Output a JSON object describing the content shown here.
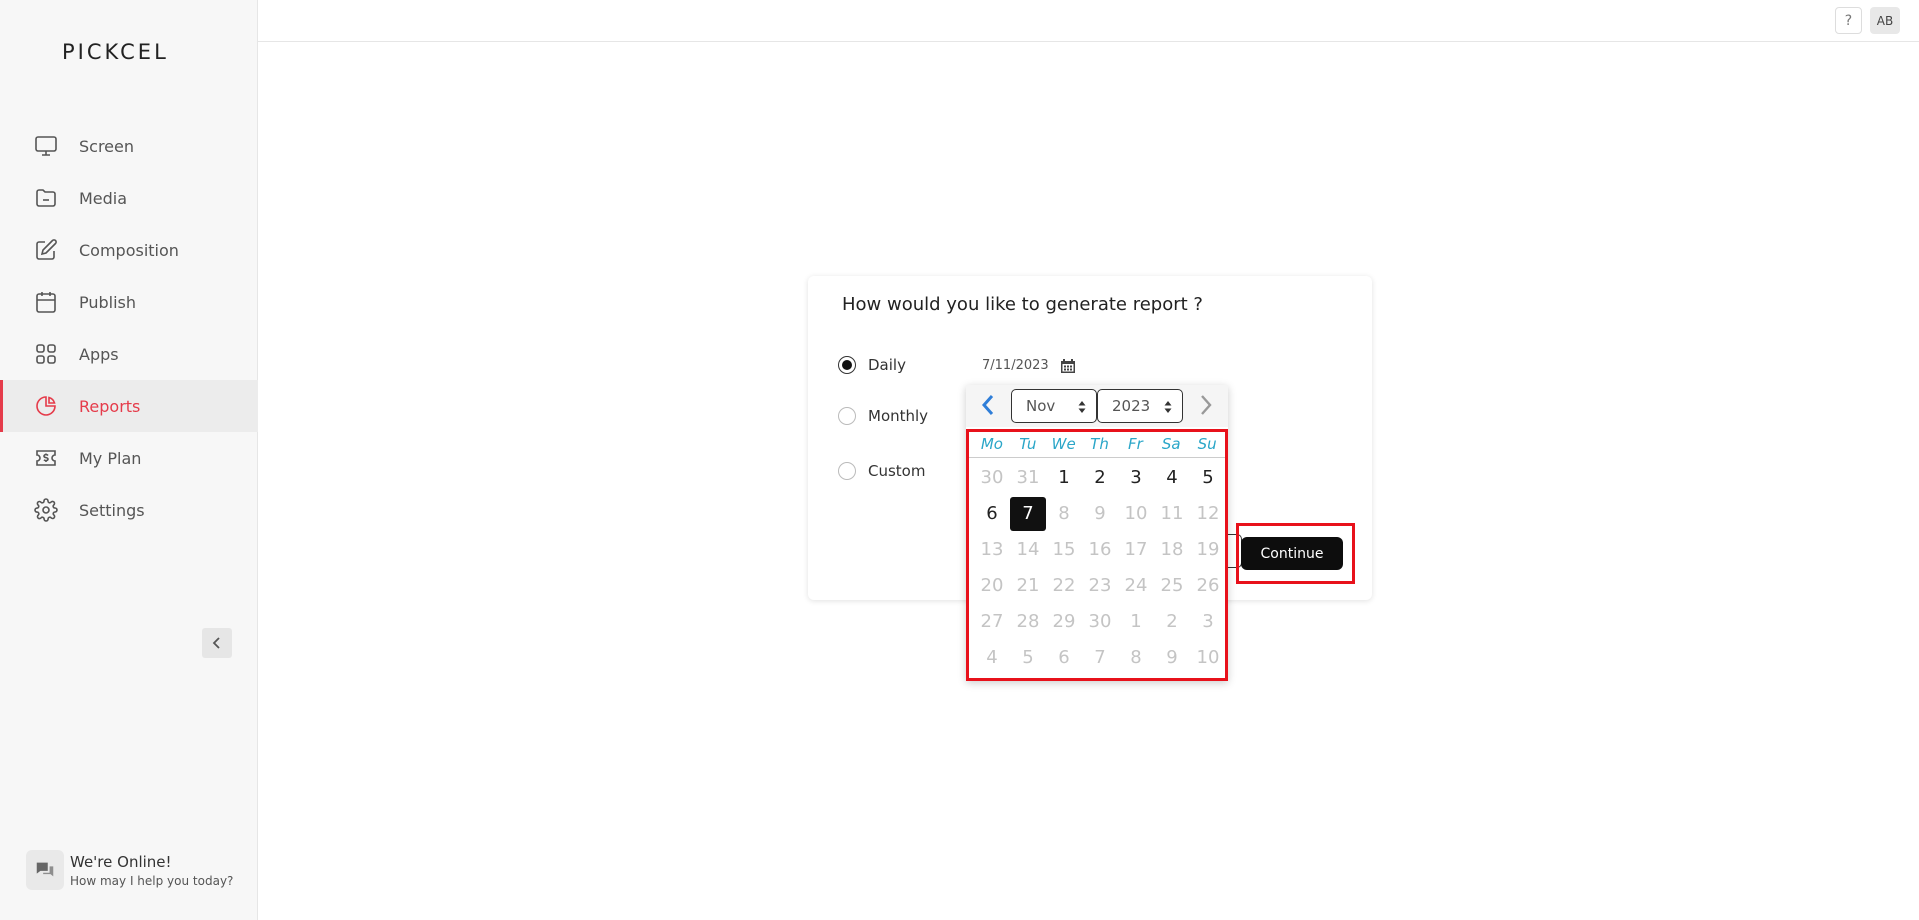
{
  "app": {
    "logo": "PICKCEL"
  },
  "sidebar": {
    "items": [
      {
        "label": "Screen",
        "icon": "monitor-icon"
      },
      {
        "label": "Media",
        "icon": "folder-icon"
      },
      {
        "label": "Composition",
        "icon": "edit-icon"
      },
      {
        "label": "Publish",
        "icon": "calendar-icon"
      },
      {
        "label": "Apps",
        "icon": "apps-grid-icon"
      },
      {
        "label": "Reports",
        "icon": "pie-chart-icon",
        "active": true
      },
      {
        "label": "My Plan",
        "icon": "dollar-ticket-icon"
      },
      {
        "label": "Settings",
        "icon": "gear-icon"
      }
    ],
    "active_color": "#e53b4a"
  },
  "chat": {
    "title": "We're Online!",
    "subtitle": "How may I help you today?"
  },
  "header": {
    "help": "?",
    "avatar": "AB"
  },
  "dialog": {
    "title": "How would you like to generate report ?",
    "options": [
      {
        "label": "Daily",
        "checked": true
      },
      {
        "label": "Monthly",
        "checked": false
      },
      {
        "label": "Custom",
        "checked": false
      }
    ],
    "date_value": "7/11/2023",
    "continue_label": "Continue"
  },
  "datepicker": {
    "month": "Nov",
    "year": "2023",
    "weekdays": [
      "Mo",
      "Tu",
      "We",
      "Th",
      "Fr",
      "Sa",
      "Su"
    ],
    "weeks": [
      [
        "30",
        "31",
        "1",
        "2",
        "3",
        "4",
        "5"
      ],
      [
        "6",
        "7",
        "8",
        "9",
        "10",
        "11",
        "12"
      ],
      [
        "13",
        "14",
        "15",
        "16",
        "17",
        "18",
        "19"
      ],
      [
        "20",
        "21",
        "22",
        "23",
        "24",
        "25",
        "26"
      ],
      [
        "27",
        "28",
        "29",
        "30",
        "1",
        "2",
        "3"
      ],
      [
        "4",
        "5",
        "6",
        "7",
        "8",
        "9",
        "10"
      ]
    ],
    "selected_day": "7",
    "highlight_color": "#e8111b"
  }
}
